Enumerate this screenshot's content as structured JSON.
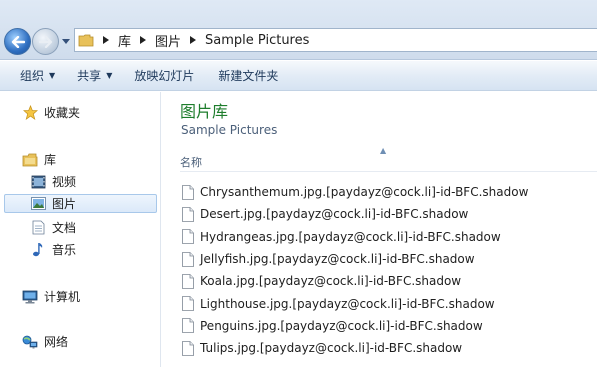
{
  "address": {
    "crumbs": [
      "库",
      "图片",
      "Sample Pictures"
    ]
  },
  "toolbar": {
    "organize": "组织",
    "share": "共享",
    "slideshow": "放映幻灯片",
    "new_folder": "新建文件夹"
  },
  "nav": {
    "favorites": "收藏夹",
    "libraries": "库",
    "videos": "视频",
    "pictures": "图片",
    "documents": "文档",
    "music": "音乐",
    "computer": "计算机",
    "network": "网络"
  },
  "content": {
    "title": "图片库",
    "subtitle": "Sample Pictures",
    "column_name": "名称",
    "files": [
      "Chrysanthemum.jpg.[paydayz@cock.li]-id-BFC.shadow",
      "Desert.jpg.[paydayz@cock.li]-id-BFC.shadow",
      "Hydrangeas.jpg.[paydayz@cock.li]-id-BFC.shadow",
      "Jellyfish.jpg.[paydayz@cock.li]-id-BFC.shadow",
      "Koala.jpg.[paydayz@cock.li]-id-BFC.shadow",
      "Lighthouse.jpg.[paydayz@cock.li]-id-BFC.shadow",
      "Penguins.jpg.[paydayz@cock.li]-id-BFC.shadow",
      "Tulips.jpg.[paydayz@cock.li]-id-BFC.shadow"
    ]
  },
  "colors": {
    "title_green": "#1e7d2c",
    "selection": "#dbe9f9"
  }
}
